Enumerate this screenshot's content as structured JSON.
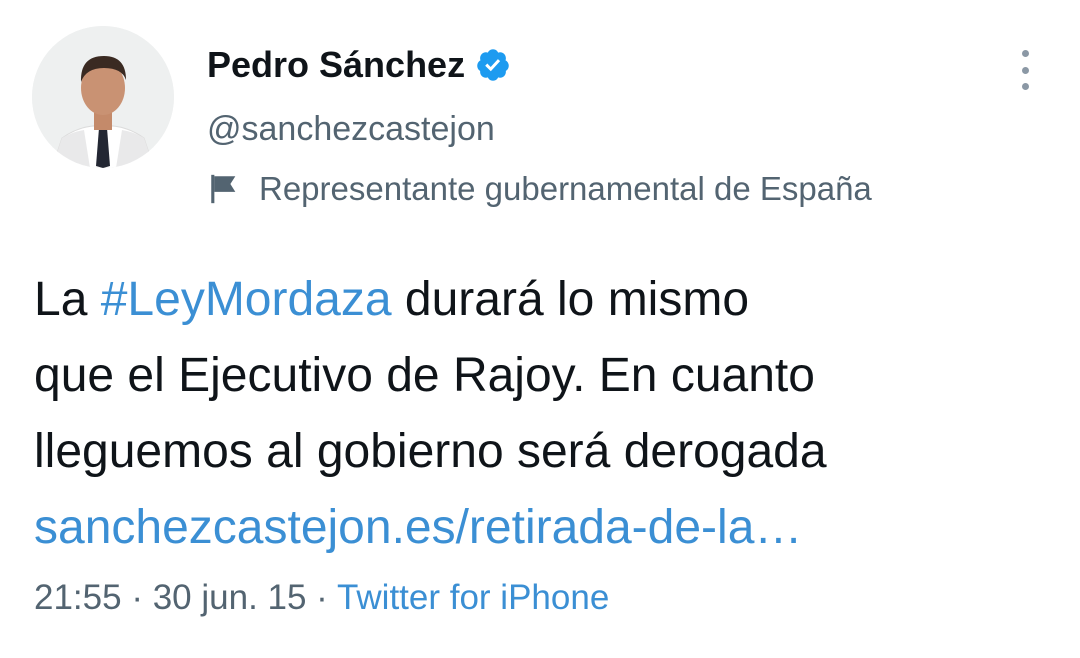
{
  "author": {
    "display_name": "Pedro Sánchez",
    "handle": "@sanchezcastejon",
    "verified": true,
    "label": "Representante gubernamental de España",
    "label_icon": "flag-icon"
  },
  "tweet": {
    "text_prefix": "La ",
    "hashtag": "#LeyMordaza",
    "text_line1_rest": " durará lo mismo",
    "text_line2": "que el Ejecutivo de Rajoy. En cuanto",
    "text_line3": "lleguemos al gobierno será derogada",
    "link": "sanchezcastejon.es/retirada-de-la…"
  },
  "meta": {
    "time": "21:55",
    "sep1": " · ",
    "date": "30 jun. 15",
    "sep2": " · ",
    "source": "Twitter for iPhone"
  },
  "colors": {
    "link": "#3b8fd4",
    "verified": "#1d9bf0",
    "text": "#0f1419",
    "secondary": "#536471"
  }
}
